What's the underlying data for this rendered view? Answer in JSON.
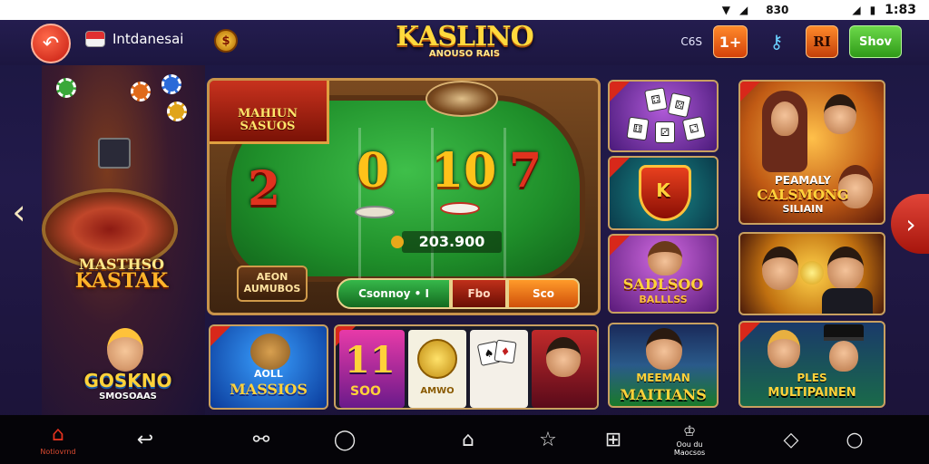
{
  "status_bar": {
    "wifi_icon": "wifi-icon",
    "signal_icon": "signal-icon",
    "battery_text": "830",
    "time": "1:83"
  },
  "header": {
    "back_icon": "back-circle-icon",
    "region_label": "Intdanesai",
    "flag_icon": "flag-icon",
    "badge_icon": "coin-badge-icon",
    "logo_title": "KASLINO",
    "logo_subtitle": "ANOUSO RAIS",
    "right_text": "C6S",
    "orange_btn_label": "1+",
    "rank_btn_label": "RI",
    "show_btn_label": "Shov",
    "brand_colors": {
      "accent": "#ffd93d",
      "red": "#d8281a",
      "green": "#3fbf4a"
    }
  },
  "hall": {
    "sign_top": "MASTHSO",
    "sign_bottom": "KASTAK",
    "logo_top": "GOSKNO",
    "logo_bottom": "SMOSOAAS"
  },
  "table": {
    "sign_text": "MAHIUN SASUOS",
    "numbers": [
      "2",
      "0",
      "10",
      "7"
    ],
    "pot_value": "203.900",
    "plate_text": "AEON AUMUBOS",
    "action_green": "Csonnoy • I",
    "action_red": "Fbo",
    "action_orange": "Sco"
  },
  "thumbnails": {
    "dice": {
      "name": "dice-game"
    },
    "shield": {
      "label": "K"
    },
    "lady": {
      "label_top": "SADLSOO",
      "label_bottom": "BALLLSS"
    },
    "slots_card": {
      "label_top": "AOLL",
      "label_bottom": "MASSIOS"
    },
    "combo": {
      "num": "11",
      "num_sub": "SOO",
      "coin_label": "AMWO"
    },
    "football": {
      "label_top": "MEEMAN",
      "label_bottom": "MAITIANS"
    },
    "promo": {
      "label_top": "PEAMALY",
      "label_mid": "CALSMONG",
      "label_bottom": "SILIAIN"
    },
    "duo": {},
    "multi": {
      "label_top": "PLES",
      "label_bottom": "MULTIPAINEN"
    }
  },
  "bottom_nav": {
    "home_label": "Notiovrnd",
    "items": [
      "home-icon",
      "back-arrow-icon",
      "connect-icon",
      "chat-icon",
      "house-outline-icon",
      "star-icon",
      "dice-square-icon",
      "profile-icon",
      "tag-icon",
      "circle-icon"
    ],
    "profile_label": "Oou du Maocsos"
  }
}
